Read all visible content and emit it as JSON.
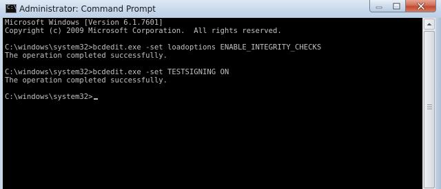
{
  "window": {
    "title": "Administrator: Command Prompt",
    "app_icon_glyph": "C:\\",
    "controls": {
      "minimize_icon": "minimize-icon",
      "maximize_icon": "maximize-icon",
      "close_icon": "close-icon"
    }
  },
  "console": {
    "text_color": "#c0c0c0",
    "background_color": "#000000",
    "lines": [
      "Microsoft Windows [Version 6.1.7601]",
      "Copyright (c) 2009 Microsoft Corporation.  All rights reserved.",
      "",
      "C:\\windows\\system32>bcdedit.exe -set loadoptions ENABLE_INTEGRITY_CHECKS",
      "The operation completed successfully.",
      "",
      "C:\\windows\\system32>bcdedit.exe -set TESTSIGNING ON",
      "The operation completed successfully.",
      "",
      "C:\\windows\\system32>"
    ]
  },
  "colors": {
    "titlebar": "#c9d9ec",
    "close_button": "#c14a31"
  }
}
